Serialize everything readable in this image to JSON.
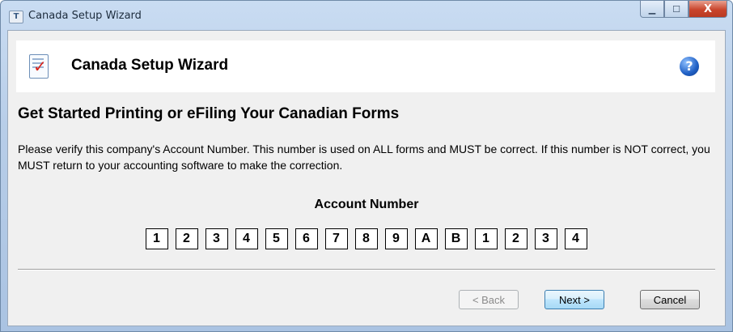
{
  "window": {
    "title": "Canada Setup Wizard",
    "app_icon_glyph": "T",
    "controls": {
      "minimize": "▁",
      "maximize": "☐",
      "close": "X"
    }
  },
  "header": {
    "title": "Canada Setup Wizard",
    "icon": "checklist-icon",
    "help_glyph": "?"
  },
  "main": {
    "heading": "Get Started Printing or eFiling Your Canadian Forms",
    "instructions": "Please verify this company's Account Number. This number is used on ALL forms and MUST be correct. If this number is NOT correct, you MUST return to your accounting software to make the correction.",
    "account_label": "Account Number",
    "account_digits": [
      "1",
      "2",
      "3",
      "4",
      "5",
      "6",
      "7",
      "8",
      "9",
      "A",
      "B",
      "1",
      "2",
      "3",
      "4"
    ]
  },
  "buttons": {
    "back": "< Back",
    "next": "Next >",
    "cancel": "Cancel"
  },
  "colors": {
    "accent": "#3c7fb1",
    "close_button": "#c9452d",
    "check_mark": "#d9231b"
  }
}
